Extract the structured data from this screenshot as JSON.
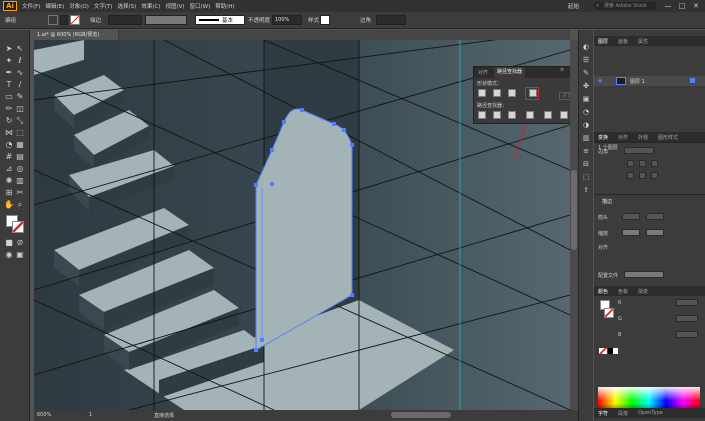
{
  "app": {
    "logo": "Ai"
  },
  "menubar": {
    "items": [
      "文件(F)",
      "编辑(E)",
      "对象(O)",
      "文字(T)",
      "选择(S)",
      "效果(C)",
      "视图(V)",
      "窗口(W)",
      "帮助(H)"
    ],
    "workspace": "起始",
    "stock_search_placeholder": "搜索 Adobe Stock",
    "minimize": "—",
    "maximize": "□",
    "close": "✕"
  },
  "controlbar": {
    "selection_label": "编组",
    "stroke_label": "描边",
    "stroke_style": "基本",
    "opacity_label": "不透明度",
    "opacity_value": "100%",
    "style_label": "样式",
    "corner_label": "边角"
  },
  "document": {
    "tab_title": "1.ai* @ 600% (RGB/预览)",
    "zoom": "600%",
    "page": "1",
    "status_text": "直接选择"
  },
  "pathfinder": {
    "tab_transform": "对齐",
    "tab_pathfinder": "路径查找器",
    "shape_modes_label": "形状模式：",
    "pathfinders_label": "路径查找器：",
    "expand_button": "扩展"
  },
  "layers_panel": {
    "tabs": [
      "图层",
      "画板",
      "属性"
    ],
    "layer_name": "图层 1",
    "layer_count": "1 个图层"
  },
  "transform_panel": {
    "tabs": [
      "变换",
      "对齐",
      "外观",
      "图形样式"
    ],
    "corner_label": "边角",
    "stroke_title": "描边",
    "arrow_label": "箭头",
    "scale_label": "缩放",
    "align_label": "对齐",
    "profile_label": "配置文件"
  },
  "color_panel": {
    "tabs": [
      "颜色",
      "色板",
      "渐变"
    ],
    "channels": [
      "R",
      "G",
      "B"
    ],
    "color_accent": "#e0262c"
  },
  "char_panel": {
    "tabs": [
      "字符",
      "段落",
      "OpenType"
    ]
  },
  "colors": {
    "selection": "#4f81ff",
    "guide": "#2aa1b0",
    "highlight_box": "#e0262c"
  }
}
